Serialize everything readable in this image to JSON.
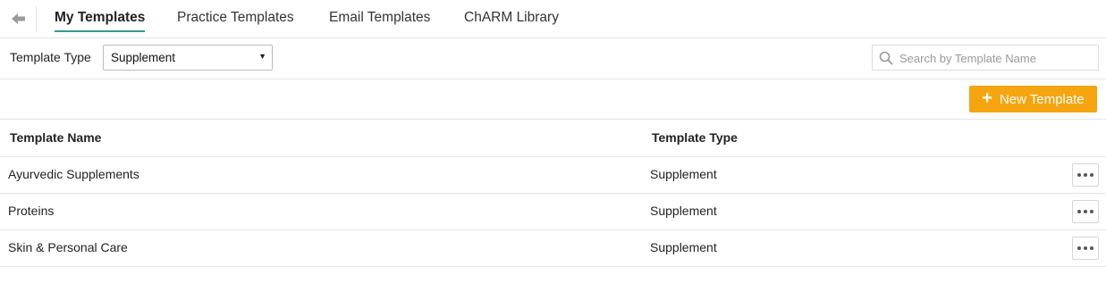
{
  "nav": {
    "tabs": [
      {
        "label": "My Templates",
        "active": true
      },
      {
        "label": "Practice Templates",
        "active": false
      },
      {
        "label": "Email Templates",
        "active": false
      },
      {
        "label": "ChARM Library",
        "active": false
      }
    ]
  },
  "filter": {
    "type_label": "Template Type",
    "type_selected": "Supplement",
    "search_placeholder": "Search by Template Name",
    "search_value": ""
  },
  "actions": {
    "new_template_label": "New Template"
  },
  "table": {
    "headers": {
      "name": "Template Name",
      "type": "Template Type"
    },
    "rows": [
      {
        "name": "Ayurvedic Supplements",
        "type": "Supplement"
      },
      {
        "name": "Proteins",
        "type": "Supplement"
      },
      {
        "name": "Skin & Personal Care",
        "type": "Supplement"
      }
    ]
  },
  "colors": {
    "accent": "#f5a50f",
    "active_tab_underline": "#3a9a8c",
    "border": "#e4e4e4"
  },
  "icons": {
    "back": "arrow-left-icon",
    "search": "search-icon",
    "dropdown": "caret-down-icon",
    "plus": "plus-icon",
    "more": "more-horizontal-icon"
  }
}
